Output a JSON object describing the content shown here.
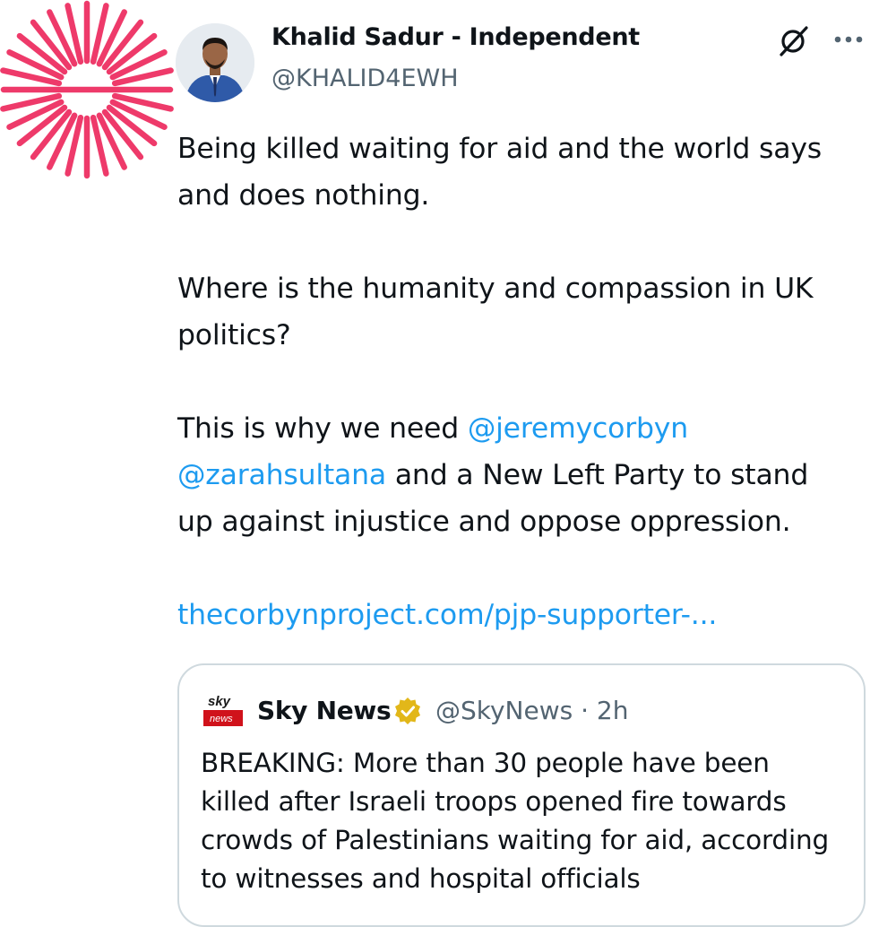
{
  "tweet": {
    "author_name": "Khalid Sadur - Independent",
    "author_handle": "@KHALID4EWH",
    "icons": {
      "logo": "pink-sunburst-logo",
      "action": "grok-icon",
      "menu": "more-dots-icon"
    },
    "text": {
      "line1": "Being killed waiting for aid and the world says",
      "line2": "and does nothing.",
      "line3": "Where is the humanity and compassion in UK",
      "line4": "politics?",
      "line5_prefix": "This is why we need ",
      "mention1": "@jeremycorbyn",
      "mention2": "@zarahsultana",
      "line6_suffix": " and a New Left Party to stand",
      "line7": "up against injustice and oppose oppression.",
      "link": "thecorbynproject.com/pjp-supporter-..."
    }
  },
  "quote": {
    "logo_text_top": "sky",
    "logo_text_bottom": "news",
    "name": "Sky News",
    "handle_time": "@SkyNews · 2h",
    "verified_icon": "gold-verified-badge-icon",
    "text": {
      "line1": "BREAKING: More than 30 people have been",
      "line2": "killed after Israeli troops opened fire towards",
      "line3": "crowds of Palestinians waiting for aid, according",
      "line4": "to witnesses and hospital officials"
    }
  },
  "colors": {
    "logo_pink": "#ee3a6a",
    "link_blue": "#1d9bf0",
    "secondary_text": "#536471",
    "border": "#cfd9de",
    "sky_red": "#d0121b",
    "badge_gold": "#e2b719"
  }
}
